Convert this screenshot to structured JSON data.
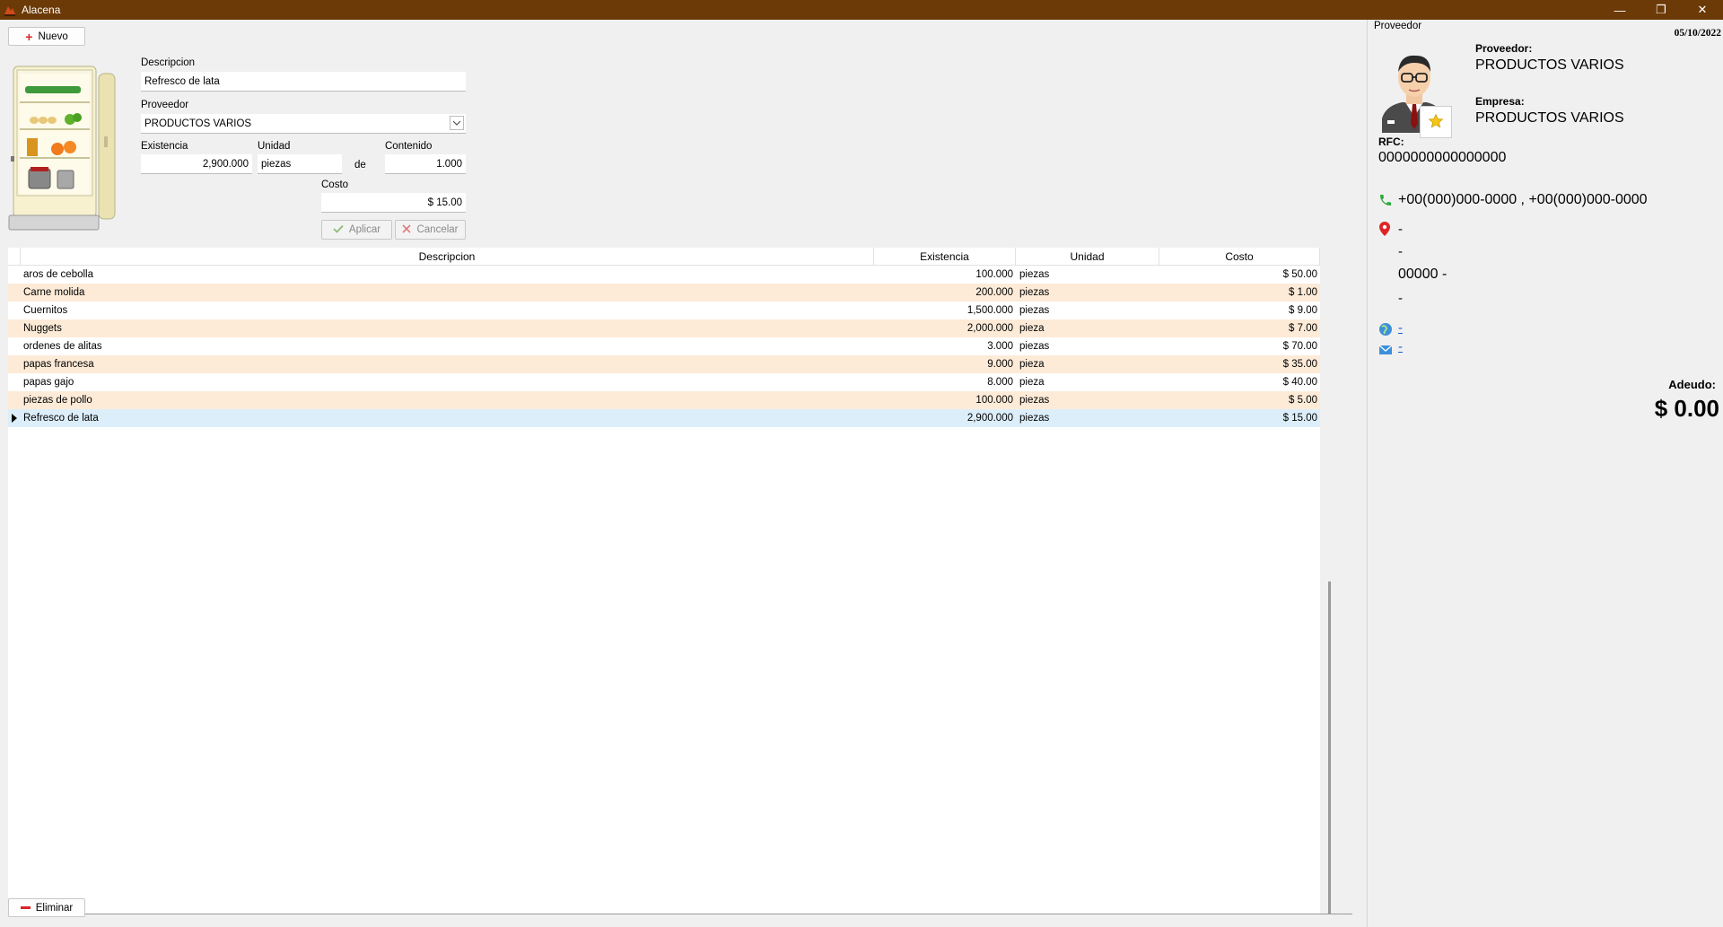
{
  "window": {
    "title": "Alacena",
    "minimize": "—",
    "restore": "❐",
    "close": "✕"
  },
  "toolbar": {
    "new_label": "Nuevo",
    "delete_label": "Eliminar"
  },
  "form": {
    "descripcion_label": "Descripcion",
    "descripcion_value": "Refresco de lata",
    "proveedor_label": "Proveedor",
    "proveedor_value": "PRODUCTOS VARIOS",
    "existencia_label": "Existencia",
    "existencia_value": "2,900.000",
    "unidad_label": "Unidad",
    "unidad_value": "piezas",
    "de_label": "de",
    "contenido_label": "Contenido",
    "contenido_value": "1.000",
    "costo_label": "Costo",
    "costo_value": "$ 15.00",
    "apply_label": "Aplicar",
    "cancel_label": "Cancelar"
  },
  "table": {
    "headers": [
      "Descripcion",
      "Existencia",
      "Unidad",
      "Costo"
    ],
    "rows": [
      {
        "descripcion": "aros de cebolla",
        "existencia": "100.000",
        "unidad": "piezas",
        "costo": "$ 50.00"
      },
      {
        "descripcion": "Carne molida",
        "existencia": "200.000",
        "unidad": "piezas",
        "costo": "$ 1.00"
      },
      {
        "descripcion": "Cuernitos",
        "existencia": "1,500.000",
        "unidad": "piezas",
        "costo": "$ 9.00"
      },
      {
        "descripcion": "Nuggets",
        "existencia": "2,000.000",
        "unidad": "pieza",
        "costo": "$ 7.00"
      },
      {
        "descripcion": "ordenes de alitas",
        "existencia": "3.000",
        "unidad": "piezas",
        "costo": "$ 70.00"
      },
      {
        "descripcion": "papas francesa",
        "existencia": "9.000",
        "unidad": "pieza",
        "costo": "$ 35.00"
      },
      {
        "descripcion": "papas gajo",
        "existencia": "8.000",
        "unidad": "pieza",
        "costo": "$ 40.00"
      },
      {
        "descripcion": "piezas de pollo",
        "existencia": "100.000",
        "unidad": "piezas",
        "costo": "$ 5.00"
      },
      {
        "descripcion": "Refresco de lata",
        "existencia": "2,900.000",
        "unidad": "piezas",
        "costo": "$ 15.00"
      }
    ],
    "selected_index": 8
  },
  "supplier_panel": {
    "section_label": "Proveedor",
    "date": "05/10/2022",
    "proveedor_label": "Proveedor:",
    "proveedor_value": "PRODUCTOS VARIOS",
    "empresa_label": "Empresa:",
    "empresa_value": "PRODUCTOS VARIOS",
    "rfc_label": "RFC:",
    "rfc_value": "0000000000000000",
    "phones": "+00(000)000-0000 ,  +00(000)000-0000",
    "address_line1": "-",
    "address_line2": "-",
    "address_line3": "00000  -",
    "address_line4": "-",
    "web": "-",
    "email": "-",
    "adeudo_label": "Adeudo:",
    "adeudo_value": "$ 0.00"
  },
  "colors": {
    "titlebar": "#6b3a07",
    "row_alt": "#fdebd8",
    "row_selected": "#dceefa",
    "add_icon": "#d9262a"
  }
}
